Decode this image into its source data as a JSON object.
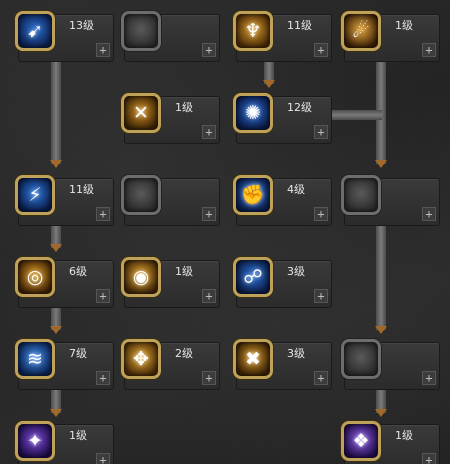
{
  "plus_label": "+",
  "skills": [
    {
      "key": "s_r0c0",
      "level": "13级",
      "icon": "blue-dash-icon",
      "glyph": "➹",
      "gradient": [
        "#2a6fd1",
        "#0c1e4a"
      ],
      "locked": false
    },
    {
      "key": "s_r0c1",
      "level": "",
      "icon": "locked-skill-icon",
      "glyph": "",
      "gradient": [
        "#5a5a5a",
        "#2a2a2a"
      ],
      "locked": true
    },
    {
      "key": "s_r0c2",
      "level": "11级",
      "icon": "golden-figure-icon",
      "glyph": "♆",
      "gradient": [
        "#d49a2a",
        "#4a2a08"
      ],
      "locked": false
    },
    {
      "key": "s_r0c3",
      "level": "1级",
      "icon": "golden-kick-icon",
      "glyph": "☄",
      "gradient": [
        "#e0a43a",
        "#3a1e06"
      ],
      "locked": false
    },
    {
      "key": "s_r1c1",
      "level": "1级",
      "icon": "golden-slash-icon",
      "glyph": "✕",
      "gradient": [
        "#c98a1e",
        "#3c2406"
      ],
      "locked": false
    },
    {
      "key": "s_r1c2",
      "level": "12级",
      "icon": "blue-burst-icon",
      "glyph": "✺",
      "gradient": [
        "#2b6dd6",
        "#0b1a44"
      ],
      "locked": false
    },
    {
      "key": "s_r2c0",
      "level": "11级",
      "icon": "blue-strike-icon",
      "glyph": "⚡",
      "gradient": [
        "#2e78dc",
        "#0a1b46"
      ],
      "locked": false
    },
    {
      "key": "s_r2c1",
      "level": "",
      "icon": "locked-skill-icon",
      "glyph": "",
      "gradient": [
        "#5a5a5a",
        "#2a2a2a"
      ],
      "locked": true
    },
    {
      "key": "s_r2c2",
      "level": "4级",
      "icon": "blue-punch-icon",
      "glyph": "✊",
      "gradient": [
        "#2f76d8",
        "#0c1c48"
      ],
      "locked": false
    },
    {
      "key": "s_r2c3",
      "level": "",
      "icon": "locked-skill-icon",
      "glyph": "",
      "gradient": [
        "#5a5a5a",
        "#2a2a2a"
      ],
      "locked": true
    },
    {
      "key": "s_r3c0",
      "level": "6级",
      "icon": "golden-swirl-icon",
      "glyph": "◎",
      "gradient": [
        "#d8961f",
        "#3e2206"
      ],
      "locked": false
    },
    {
      "key": "s_r3c1",
      "level": "1级",
      "icon": "golden-eye-icon",
      "glyph": "◉",
      "gradient": [
        "#dfa22c",
        "#402608"
      ],
      "locked": false
    },
    {
      "key": "s_r3c2",
      "level": "3级",
      "icon": "blue-runner-icon",
      "glyph": "☍",
      "gradient": [
        "#2c72d6",
        "#0a1a44"
      ],
      "locked": false
    },
    {
      "key": "s_r4c0",
      "level": "7级",
      "icon": "blue-wave-icon",
      "glyph": "≋",
      "gradient": [
        "#3a86e6",
        "#0c2250"
      ],
      "locked": false
    },
    {
      "key": "s_r4c1",
      "level": "2级",
      "icon": "golden-wave-icon",
      "glyph": "✥",
      "gradient": [
        "#e0a630",
        "#4a2c08"
      ],
      "locked": false
    },
    {
      "key": "s_r4c2",
      "level": "3级",
      "icon": "golden-cross-icon",
      "glyph": "✖",
      "gradient": [
        "#cf9426",
        "#3a2206"
      ],
      "locked": false
    },
    {
      "key": "s_r4c3",
      "level": "",
      "icon": "locked-skill-icon",
      "glyph": "",
      "gradient": [
        "#5a5a5a",
        "#2a2a2a"
      ],
      "locked": true
    },
    {
      "key": "s_r5c0",
      "level": "1级",
      "icon": "purple-stars-icon",
      "glyph": "✦",
      "gradient": [
        "#7a4ad6",
        "#1c0c44"
      ],
      "locked": false
    },
    {
      "key": "s_r5c3",
      "level": "1级",
      "icon": "purple-crystal-icon",
      "glyph": "❖",
      "gradient": [
        "#8a5ae0",
        "#220e4a"
      ],
      "locked": false
    }
  ]
}
